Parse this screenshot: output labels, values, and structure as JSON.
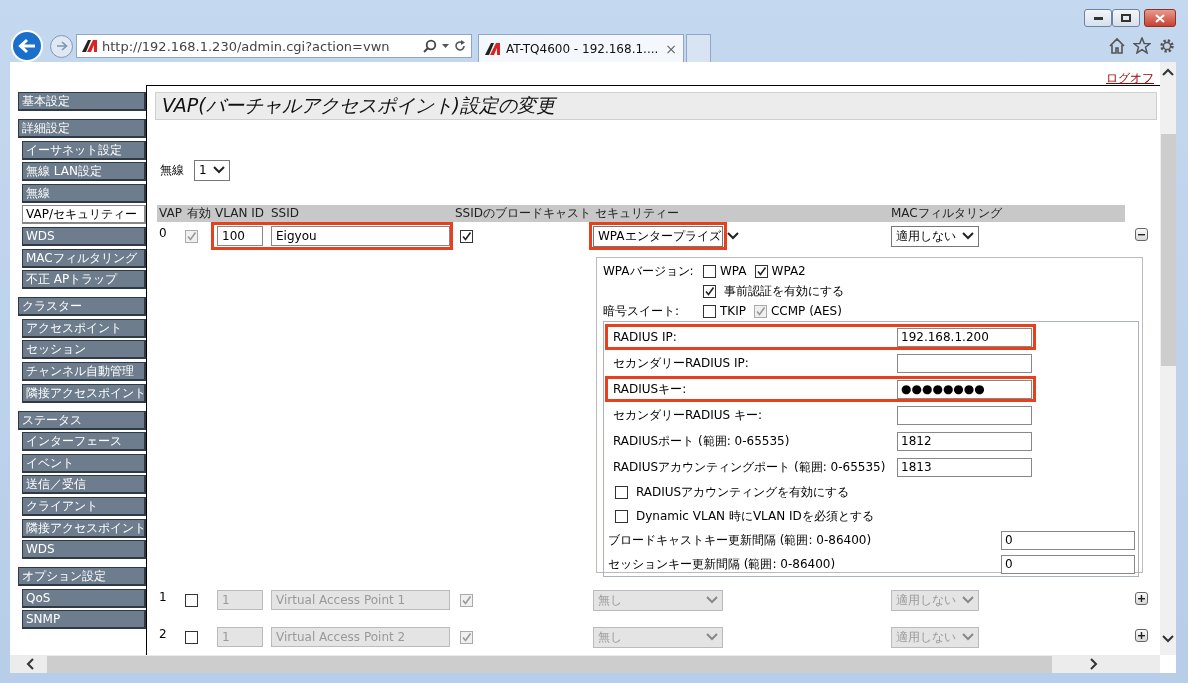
{
  "browser": {
    "address": "http://192.168.1.230/admin.cgi?action=vwn",
    "tab_title": "AT-TQ4600 - 192.168.1....",
    "tab_close": "×"
  },
  "logoff": "ログオフ",
  "sidebar": [
    {
      "label": "基本設定"
    },
    {
      "label": "詳細設定",
      "children": [
        {
          "label": "イーサネット設定",
          "selected": false
        },
        {
          "label": "無線 LAN設定",
          "selected": false
        },
        {
          "label": "無線",
          "selected": false
        },
        {
          "label": "VAP/セキュリティー",
          "selected": true
        },
        {
          "label": "WDS",
          "selected": false
        },
        {
          "label": "MACフィルタリング",
          "selected": false
        },
        {
          "label": "不正 APトラップ",
          "selected": false
        }
      ]
    },
    {
      "label": "クラスター",
      "children": [
        {
          "label": "アクセスポイント",
          "selected": false
        },
        {
          "label": "セッション",
          "selected": false
        },
        {
          "label": "チャンネル自動管理",
          "selected": false
        },
        {
          "label": "隣接アクセスポイント",
          "selected": false
        }
      ]
    },
    {
      "label": "ステータス",
      "children": [
        {
          "label": "インターフェース",
          "selected": false
        },
        {
          "label": "イベント",
          "selected": false
        },
        {
          "label": "送信／受信",
          "selected": false
        },
        {
          "label": "クライアント",
          "selected": false
        },
        {
          "label": "隣接アクセスポイント",
          "selected": false
        },
        {
          "label": "WDS",
          "selected": false
        }
      ]
    },
    {
      "label": "オプション設定",
      "children": [
        {
          "label": "QoS",
          "selected": false
        },
        {
          "label": "SNMP",
          "selected": false
        }
      ]
    }
  ],
  "page": {
    "title": "VAP(バーチャルアクセスポイント)設定の変更",
    "radio_label": "無線",
    "radio_value": "1"
  },
  "table": {
    "columns": [
      "VAP",
      "有効",
      "VLAN ID",
      "SSID",
      "SSIDのブロードキャスト",
      "セキュリティー",
      "MACフィルタリング"
    ],
    "rows": [
      {
        "vap": "0",
        "enabled": true,
        "enabled_locked": true,
        "vlan_id": "100",
        "ssid": "Eigyou",
        "broadcast": true,
        "security": "WPAエンタープライズ",
        "mac_filter": "適用しない",
        "disabled": false,
        "expanded": true,
        "ssid_highlighted": true,
        "security_highlighted": true
      },
      {
        "vap": "1",
        "enabled": false,
        "enabled_locked": false,
        "vlan_id": "1",
        "ssid": "Virtual Access Point 1",
        "broadcast": true,
        "security": "無し",
        "mac_filter": "適用しない",
        "disabled": true,
        "expanded": false,
        "ssid_highlighted": false,
        "security_highlighted": false
      },
      {
        "vap": "2",
        "enabled": false,
        "enabled_locked": false,
        "vlan_id": "1",
        "ssid": "Virtual Access Point 2",
        "broadcast": true,
        "security": "無し",
        "mac_filter": "適用しない",
        "disabled": true,
        "expanded": false,
        "ssid_highlighted": false,
        "security_highlighted": false
      }
    ]
  },
  "security_panel": {
    "wpa_version_label": "WPAバージョン:",
    "wpa_versions": [
      {
        "label": "WPA",
        "checked": false
      },
      {
        "label": "WPA2",
        "checked": true
      }
    ],
    "preauth": {
      "label": "事前認証を有効にする",
      "checked": true
    },
    "cipher_label": "暗号スイート:",
    "ciphers": [
      {
        "label": "TKIP",
        "checked": false,
        "disabled": false
      },
      {
        "label": "CCMP (AES)",
        "checked": true,
        "disabled": true
      }
    ],
    "radius_fields": [
      {
        "label": "RADIUS IP:",
        "value": "192.168.1.200",
        "highlighted": true
      },
      {
        "label": "セカンダリーRADIUS IP:",
        "highlighted": false
      },
      {
        "label": "RADIUSキー:",
        "value": "●●●●●●●●",
        "highlighted": true
      },
      {
        "label": "セカンダリーRADIUS キー:",
        "highlighted": false
      },
      {
        "label": "RADIUSポート (範囲: 0-65535)",
        "value": "1812",
        "highlighted": false
      },
      {
        "label": "RADIUSアカウンティングポート (範囲: 0-65535)",
        "value": "1813",
        "highlighted": false
      }
    ],
    "radius_options": [
      {
        "label": "RADIUSアカウンティングを有効にする",
        "checked": false
      },
      {
        "label": "Dynamic VLAN 時にVLAN IDを必須とする",
        "checked": false
      }
    ],
    "key_intervals": [
      {
        "label": "ブロードキャストキー更新間隔 (範囲: 0-86400)",
        "value": "0"
      },
      {
        "label": "セッションキー更新間隔 (範囲: 0-86400)",
        "value": "0"
      }
    ]
  }
}
